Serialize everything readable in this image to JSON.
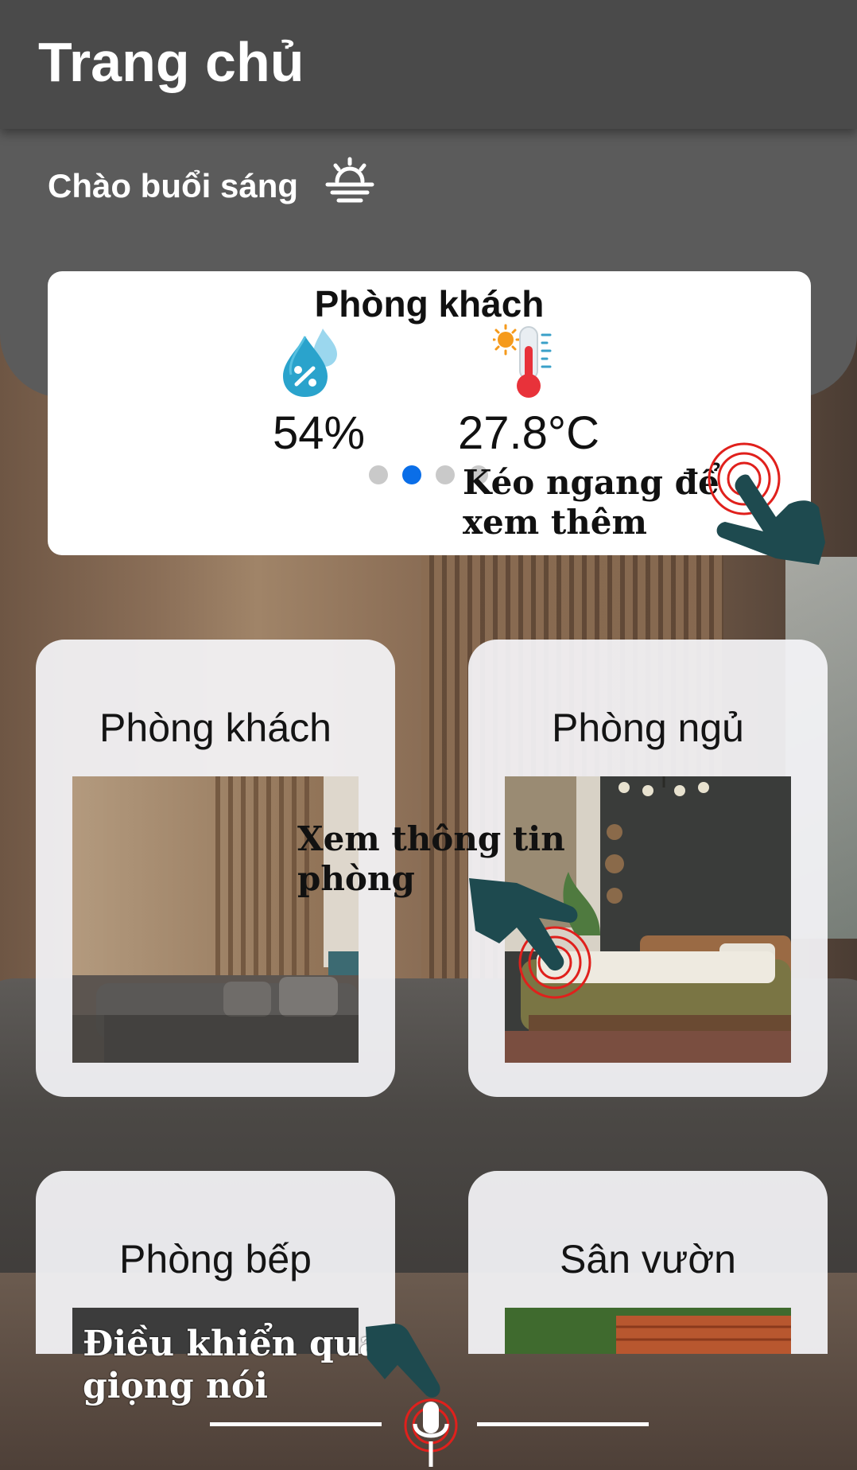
{
  "header": {
    "title": "Trang chủ"
  },
  "greeting": {
    "text": "Chào buổi sáng",
    "icon": "sunrise-icon"
  },
  "sensor_card": {
    "room": "Phòng khách",
    "humidity": {
      "icon": "humidity-drop-icon",
      "value": "54%"
    },
    "temperature": {
      "icon": "thermometer-sun-icon",
      "value": "27.8°C"
    },
    "pagination": {
      "count": 4,
      "active_index": 1
    }
  },
  "rooms": [
    {
      "name": "Phòng khách"
    },
    {
      "name": "Phòng ngủ"
    },
    {
      "name": "Phòng bếp"
    },
    {
      "name": "Sân vườn"
    }
  ],
  "hints": {
    "swipe": "Kéo ngang để xem thêm",
    "swipe_line1": "Kéo ngang để",
    "swipe_line2": "xem thêm",
    "room_info_line1": "Xem thông tin",
    "room_info_line2": "phòng",
    "voice_line1": "Điều khiển qua",
    "voice_line2": "giọng nói"
  },
  "bottom_bar": {
    "icon": "microphone-icon"
  },
  "colors": {
    "header_bg": "#4a4a4a",
    "accent_blue": "#0a6ee8",
    "pointer_hand": "#1e4a4f",
    "tap_ripple": "#e0201c"
  }
}
